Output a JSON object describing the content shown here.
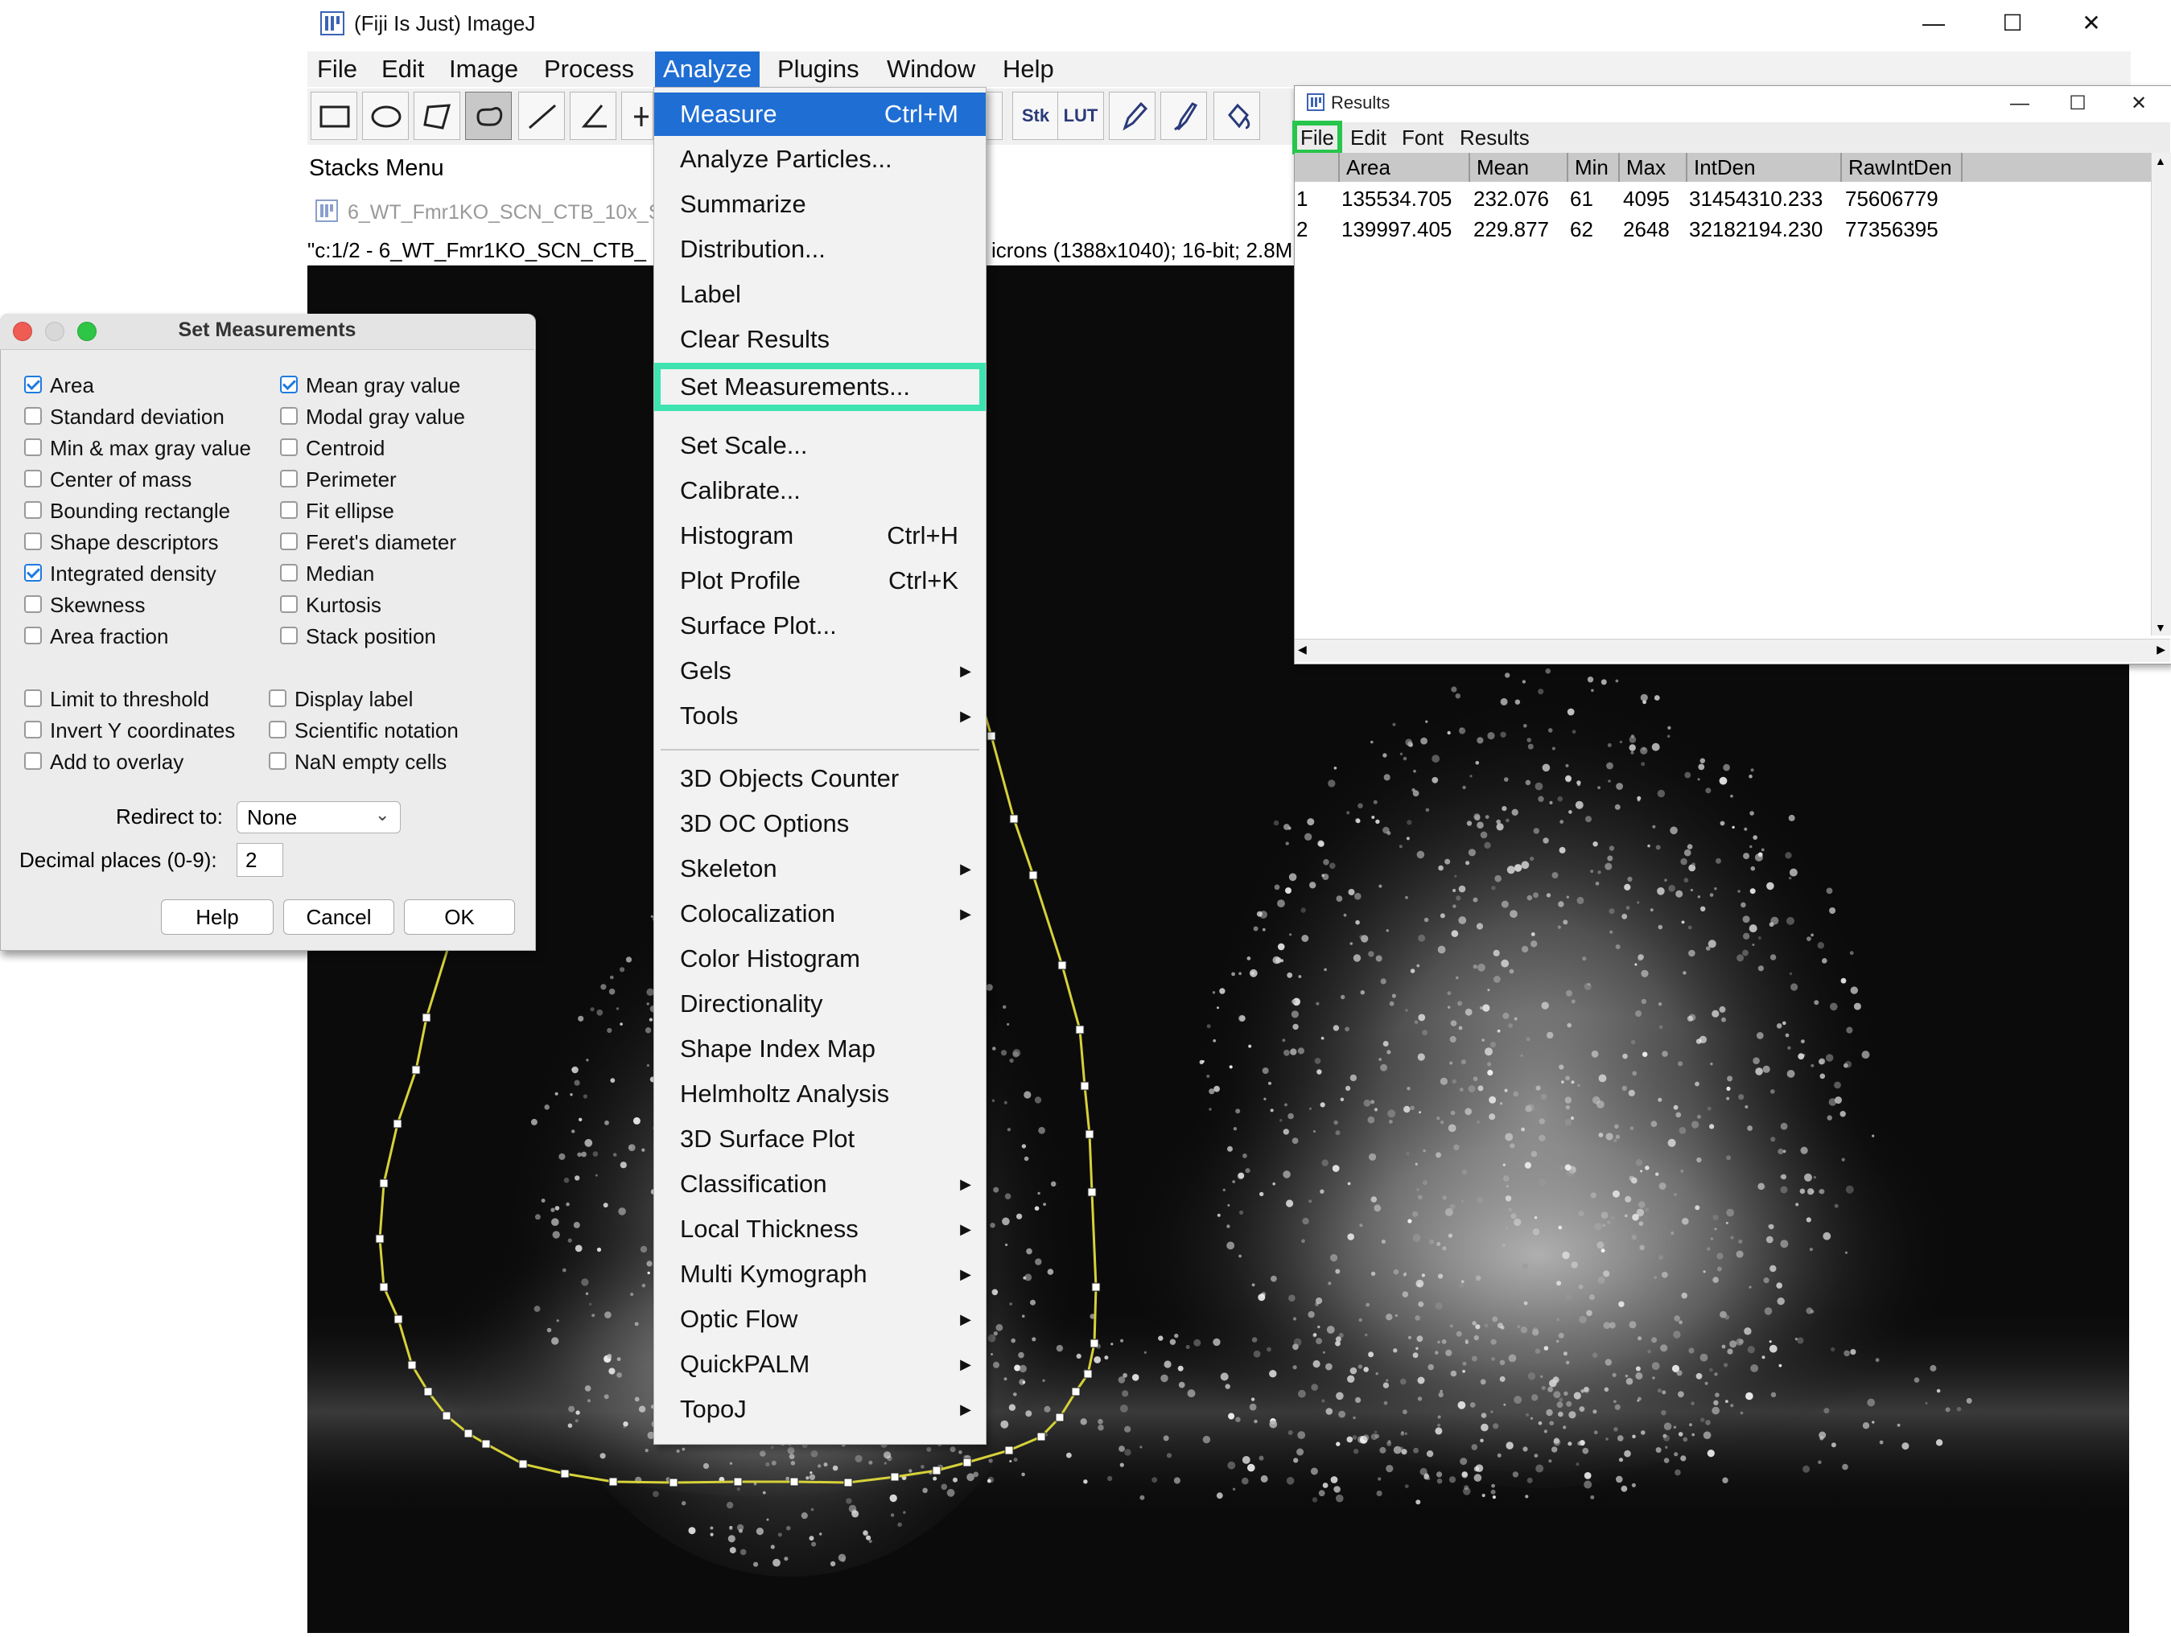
{
  "fiji": {
    "title": "(Fiji Is Just) ImageJ",
    "menus": [
      "File",
      "Edit",
      "Image",
      "Process",
      "Analyze",
      "Plugins",
      "Window",
      "Help"
    ],
    "toolbar_labels": {
      "stk": "Stk",
      "lut": "LUT"
    },
    "status": "Stacks Menu",
    "image_window_title": "6_WT_Fmr1KO_SCN_CTB_10x_Sxr",
    "image_subtitle_left": "\"c:1/2 - 6_WT_Fmr1KO_SCN_CTB_",
    "image_subtitle_right": "icrons (1388x1040); 16-bit; 2.8MB"
  },
  "analyze_menu": {
    "items": [
      {
        "label": "Measure",
        "shortcut": "Ctrl+M"
      },
      {
        "label": "Analyze Particles..."
      },
      {
        "label": "Summarize"
      },
      {
        "label": "Distribution..."
      },
      {
        "label": "Label"
      },
      {
        "label": "Clear Results"
      },
      {
        "label": "Set Measurements..."
      },
      {
        "label": "Set Scale..."
      },
      {
        "label": "Calibrate..."
      },
      {
        "label": "Histogram",
        "shortcut": "Ctrl+H"
      },
      {
        "label": "Plot Profile",
        "shortcut": "Ctrl+K"
      },
      {
        "label": "Surface Plot..."
      },
      {
        "label": "Gels"
      },
      {
        "label": "Tools"
      },
      {
        "label": "3D Objects Counter"
      },
      {
        "label": "3D OC Options"
      },
      {
        "label": "Skeleton"
      },
      {
        "label": "Colocalization"
      },
      {
        "label": "Color Histogram"
      },
      {
        "label": "Directionality"
      },
      {
        "label": "Shape Index Map"
      },
      {
        "label": "Helmholtz Analysis"
      },
      {
        "label": "3D Surface Plot"
      },
      {
        "label": "Classification"
      },
      {
        "label": "Local Thickness"
      },
      {
        "label": "Multi Kymograph"
      },
      {
        "label": "Optic Flow"
      },
      {
        "label": "QuickPALM"
      },
      {
        "label": "TopoJ"
      }
    ]
  },
  "results": {
    "title": "Results",
    "menus": [
      "File",
      "Edit",
      "Font",
      "Results"
    ],
    "columns": [
      "",
      "Area",
      "Mean",
      "Min",
      "Max",
      "IntDen",
      "RawIntDen"
    ],
    "rows": [
      [
        "1",
        "135534.705",
        "232.076",
        "61",
        "4095",
        "31454310.233",
        "75606779"
      ],
      [
        "2",
        "139997.405",
        "229.877",
        "62",
        "2648",
        "32182194.230",
        "77356395"
      ]
    ]
  },
  "set_measurements": {
    "title": "Set Measurements",
    "options_left": [
      {
        "label": "Area",
        "checked": true
      },
      {
        "label": "Standard deviation",
        "checked": false
      },
      {
        "label": "Min & max gray value",
        "checked": false
      },
      {
        "label": "Center of mass",
        "checked": false
      },
      {
        "label": "Bounding rectangle",
        "checked": false
      },
      {
        "label": "Shape descriptors",
        "checked": false
      },
      {
        "label": "Integrated density",
        "checked": true
      },
      {
        "label": "Skewness",
        "checked": false
      },
      {
        "label": "Area fraction",
        "checked": false
      }
    ],
    "options_right": [
      {
        "label": "Mean gray value",
        "checked": true
      },
      {
        "label": "Modal gray value",
        "checked": false
      },
      {
        "label": "Centroid",
        "checked": false
      },
      {
        "label": "Perimeter",
        "checked": false
      },
      {
        "label": "Fit ellipse",
        "checked": false
      },
      {
        "label": "Feret's diameter",
        "checked": false
      },
      {
        "label": "Median",
        "checked": false
      },
      {
        "label": "Kurtosis",
        "checked": false
      },
      {
        "label": "Stack position",
        "checked": false
      }
    ],
    "extra_left": [
      {
        "label": "Limit to threshold",
        "checked": false
      },
      {
        "label": "Invert Y coordinates",
        "checked": false
      },
      {
        "label": "Add to overlay",
        "checked": false
      }
    ],
    "extra_right": [
      {
        "label": "Display label",
        "checked": false
      },
      {
        "label": "Scientific notation",
        "checked": false
      },
      {
        "label": "NaN empty cells",
        "checked": false
      }
    ],
    "redirect_label": "Redirect to:",
    "redirect_value": "None",
    "decimal_label": "Decimal places (0-9):",
    "decimal_value": "2",
    "buttons": {
      "help": "Help",
      "cancel": "Cancel",
      "ok": "OK"
    }
  },
  "colors": {
    "menu_selected": "#1f6ed4",
    "highlight_box": "#3ee3b0",
    "file_highlight": "#27c54b",
    "roi_outline": "#d6d13a"
  },
  "icons": [
    "fiji-logo",
    "rectangle-tool-icon",
    "oval-tool-icon",
    "polygon-tool-icon",
    "freehand-tool-icon",
    "line-tool-icon",
    "angle-tool-icon",
    "point-tool-icon",
    "pencil-icon",
    "brush-icon",
    "flood-fill-icon"
  ]
}
